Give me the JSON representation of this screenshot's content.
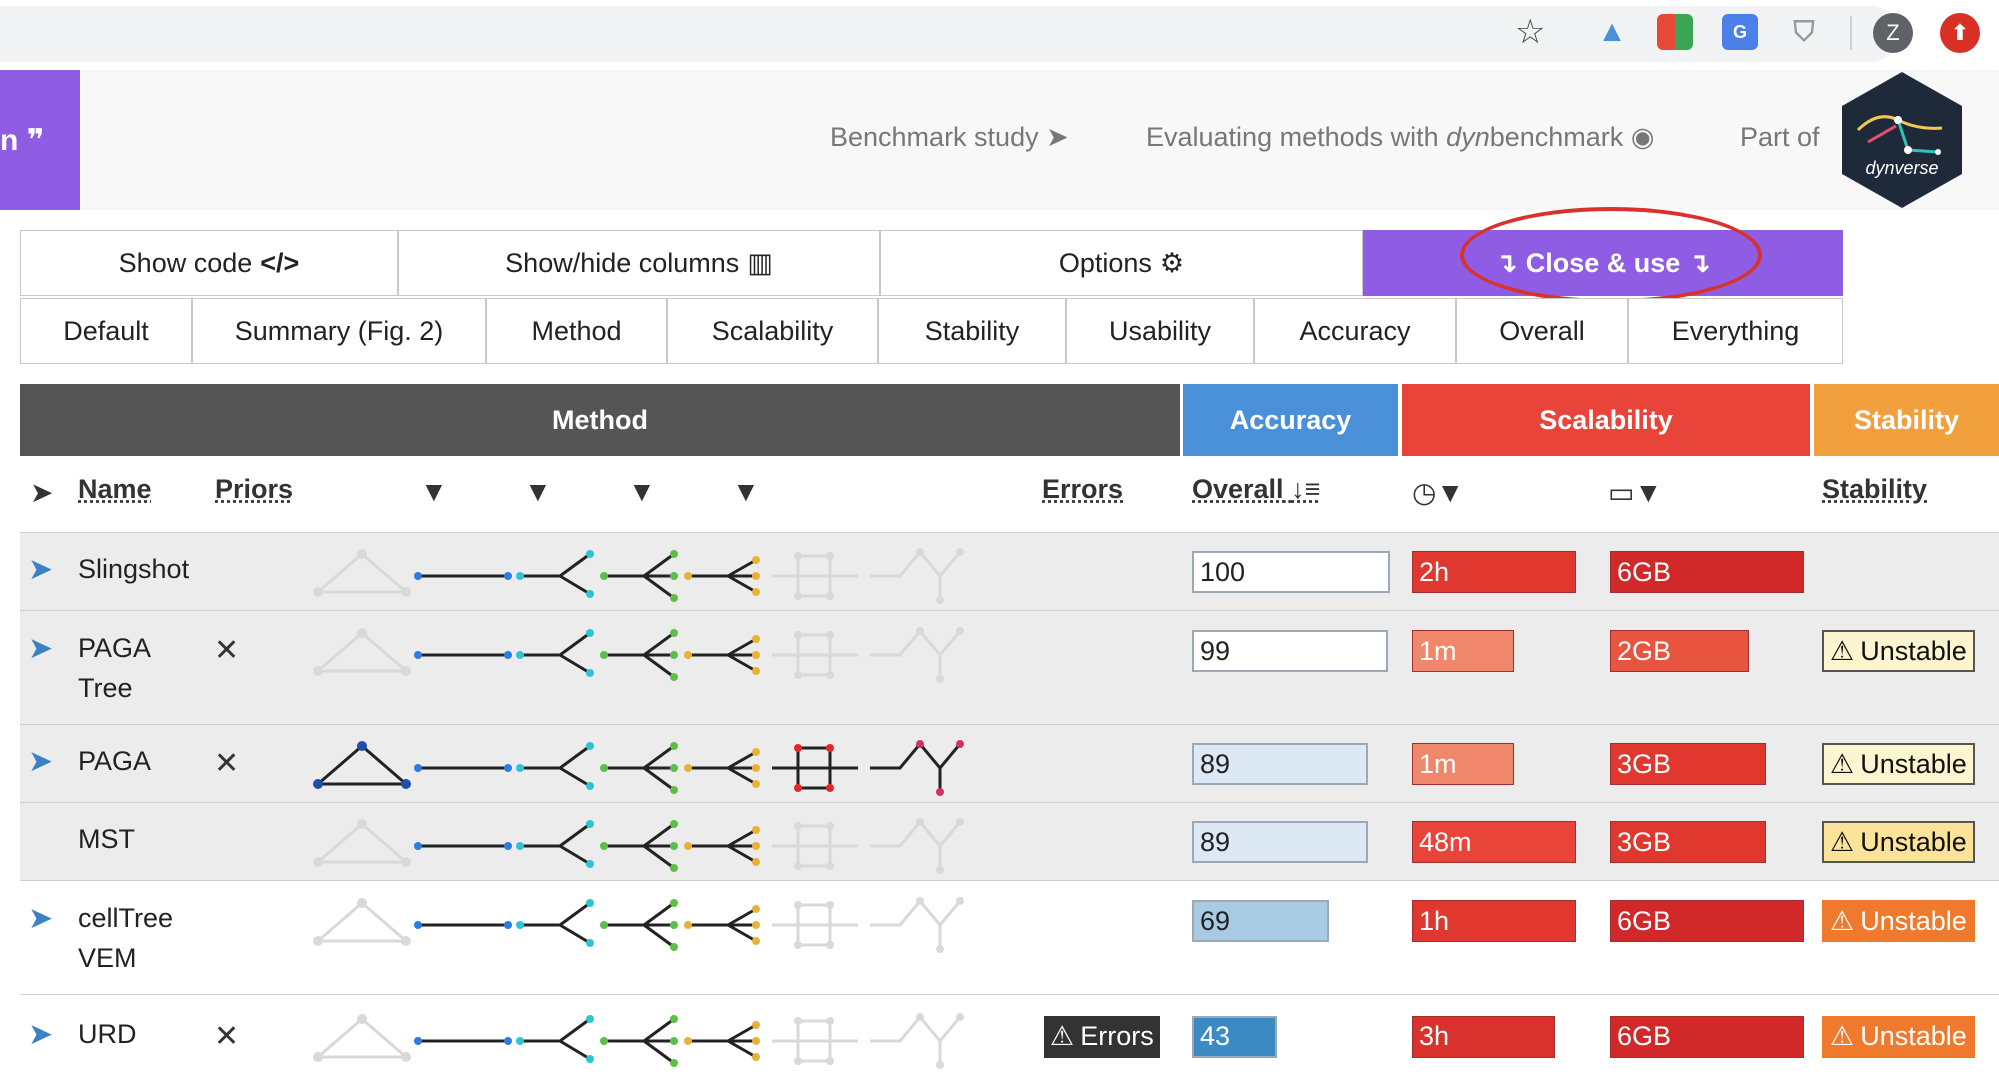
{
  "browser": {
    "profile_initial": "Z"
  },
  "header": {
    "brand_text": "n ❞",
    "nav": [
      {
        "label": "Benchmark study",
        "icon": "paper-plane-icon"
      },
      {
        "label_pre": "Evaluating methods with ",
        "label_em": "dyn",
        "label_post": "benchmark",
        "icon": "github-icon"
      }
    ],
    "part_of": "Part of",
    "logo_text": "dynverse"
  },
  "toolbar": {
    "buttons": [
      {
        "label": "Show code",
        "icon": "</>"
      },
      {
        "label": "Show/hide columns",
        "icon": "▥"
      },
      {
        "label": "Options",
        "icon": "⚙"
      },
      {
        "label": "Close & use",
        "icon": "↴"
      }
    ]
  },
  "presets": [
    "Default",
    "Summary (Fig. 2)",
    "Method",
    "Scalability",
    "Stability",
    "Usability",
    "Accuracy",
    "Overall",
    "Everything"
  ],
  "table": {
    "groups": [
      {
        "label": "Method",
        "color": "#555555"
      },
      {
        "label": "Accuracy",
        "color": "#4a90d9"
      },
      {
        "label": "Scalability",
        "color": "#e8443a"
      },
      {
        "label": "Stability",
        "color": "#f2a03d"
      }
    ],
    "columns": {
      "name": "Name",
      "priors": "Priors",
      "errors": "Errors",
      "overall": "Overall",
      "stability": "Stability"
    },
    "rows": [
      {
        "name": [
          "Slingshot"
        ],
        "plane": true,
        "prior": "",
        "errors": "",
        "overall": 100,
        "time": "2h",
        "memory": "6GB",
        "stability": "",
        "full": false
      },
      {
        "name": [
          "PAGA",
          "Tree"
        ],
        "plane": true,
        "prior": "X",
        "errors": "",
        "overall": 99,
        "time": "1m",
        "memory": "2GB",
        "stability": "Unstable",
        "full": false
      },
      {
        "name": [
          "PAGA"
        ],
        "plane": true,
        "prior": "X",
        "errors": "",
        "overall": 89,
        "time": "1m",
        "memory": "3GB",
        "stability": "Unstable",
        "full": true
      },
      {
        "name": [
          "MST"
        ],
        "plane": false,
        "prior": "",
        "errors": "",
        "overall": 89,
        "time": "48m",
        "memory": "3GB",
        "stability": "Unstable",
        "full": false
      },
      {
        "name": [
          "cellTree",
          "VEM"
        ],
        "plane": true,
        "prior": "",
        "errors": "",
        "overall": 69,
        "time": "1h",
        "memory": "6GB",
        "stability": "Unstable",
        "full": false
      },
      {
        "name": [
          "URD"
        ],
        "plane": true,
        "prior": "X",
        "errors": "Errors",
        "overall": 43,
        "time": "3h",
        "memory": "6GB",
        "stability": "Unstable",
        "full": false
      }
    ]
  }
}
